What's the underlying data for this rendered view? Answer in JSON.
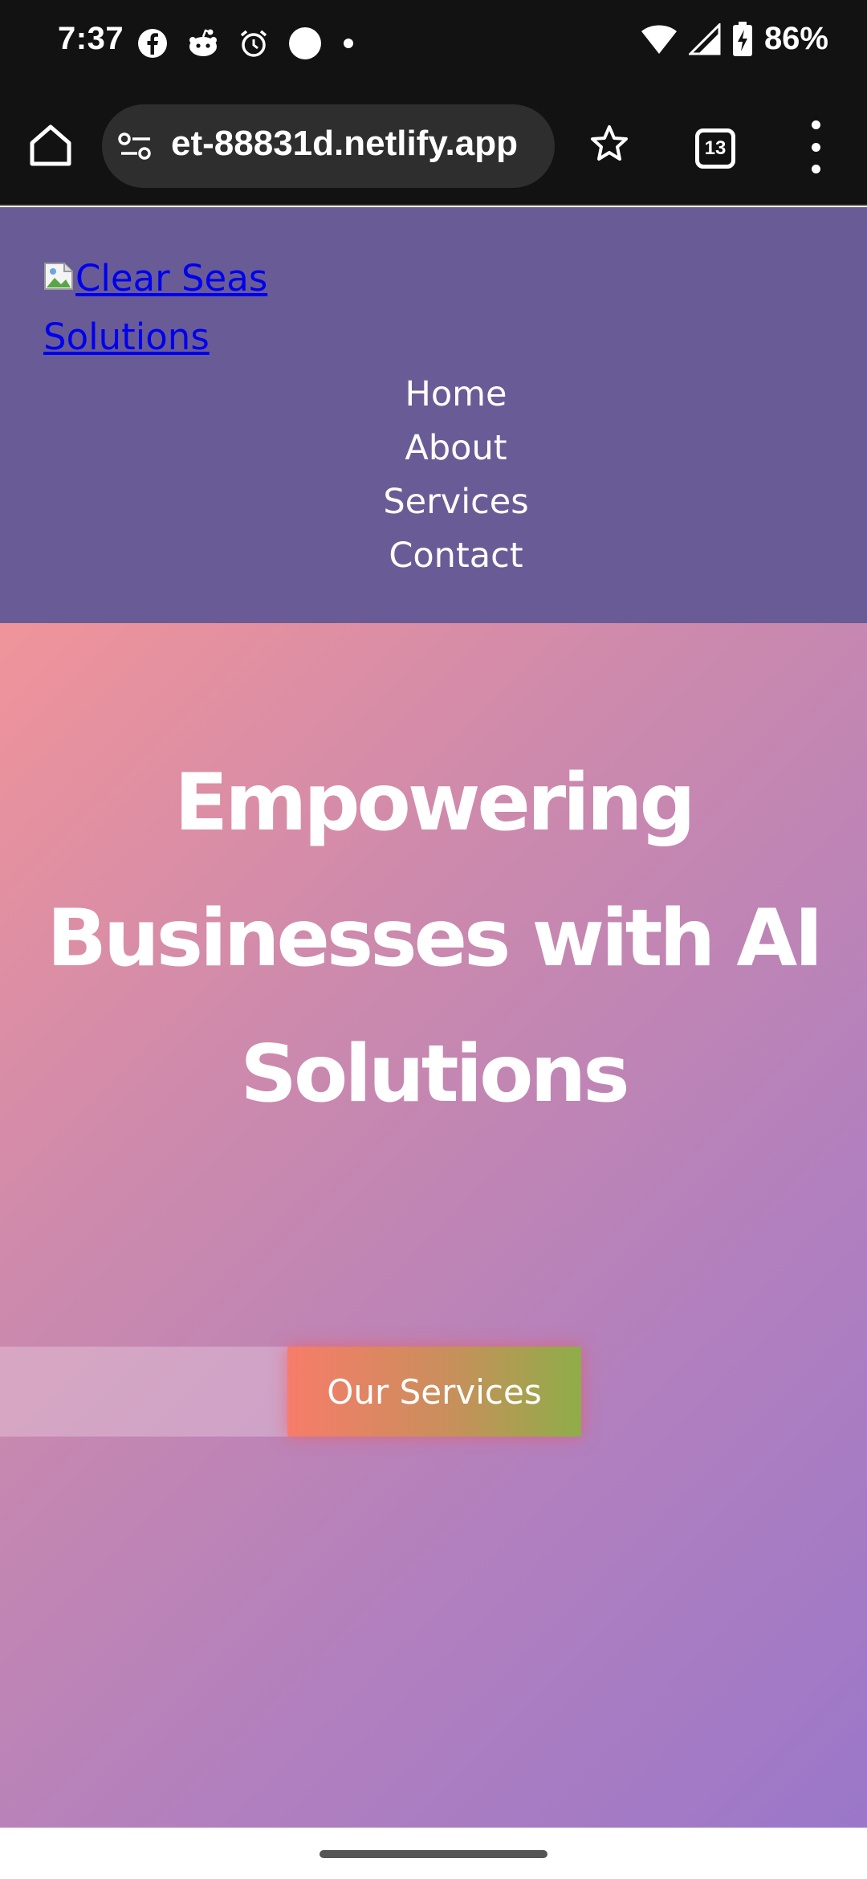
{
  "status_bar": {
    "time": "7:37",
    "battery": "86%",
    "icons_left": [
      "facebook-icon",
      "reddit-icon",
      "alarm-icon",
      "circle-icon",
      "dot-icon"
    ],
    "icons_right": [
      "wifi-icon",
      "signal-icon",
      "battery-charging-icon"
    ]
  },
  "browser": {
    "url": "et-88831d.netlify.app",
    "tab_count": "13"
  },
  "site": {
    "logo_alt": "Clear Seas Solutions",
    "nav": [
      {
        "label": "Home"
      },
      {
        "label": "About"
      },
      {
        "label": "Services"
      },
      {
        "label": "Contact"
      }
    ]
  },
  "hero": {
    "title": "Empowering Businesses with AI Solutions",
    "button_label": "Our Services"
  },
  "colors": {
    "header_bg": "#695c96",
    "hero_gradient_start": "#f0949a",
    "hero_gradient_end": "#9b77c9",
    "button_gradient_start": "#f77c6a",
    "button_gradient_end": "#8fad48",
    "link": "#0000ee"
  }
}
